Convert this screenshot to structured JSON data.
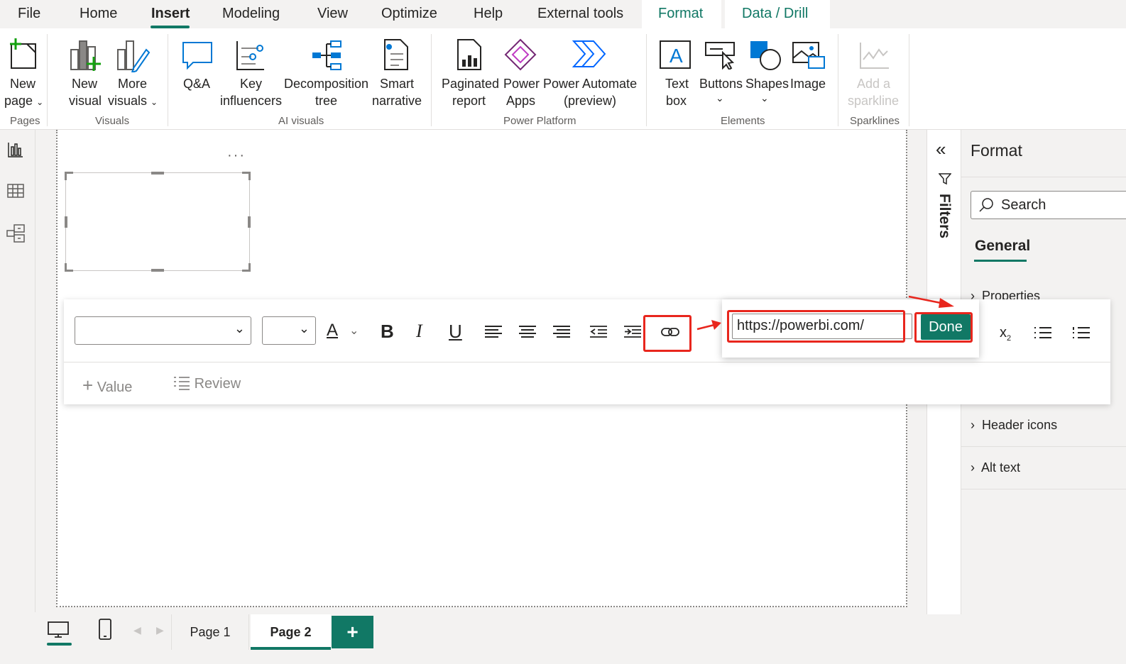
{
  "menubar": {
    "items": [
      "File",
      "Home",
      "Insert",
      "Modeling",
      "View",
      "Optimize",
      "Help",
      "External tools",
      "Format",
      "Data / Drill"
    ],
    "active": "Insert"
  },
  "ribbon": {
    "pages": {
      "new_page_1": "New",
      "new_page_2": "page",
      "group": "Pages"
    },
    "visuals": {
      "new_visual_1": "New",
      "new_visual_2": "visual",
      "more_visuals_1": "More",
      "more_visuals_2": "visuals",
      "group": "Visuals"
    },
    "ai": {
      "qa": "Q&A",
      "key_1": "Key",
      "key_2": "influencers",
      "decomp_1": "Decomposition",
      "decomp_2": "tree",
      "smart_1": "Smart",
      "smart_2": "narrative",
      "group": "AI visuals"
    },
    "platform": {
      "paginated_1": "Paginated",
      "paginated_2": "report",
      "apps_1": "Power",
      "apps_2": "Apps",
      "automate_1": "Power Automate",
      "automate_2": "(preview)",
      "group": "Power Platform"
    },
    "elements": {
      "text_1": "Text",
      "text_2": "box",
      "buttons": "Buttons",
      "shapes": "Shapes",
      "image": "Image",
      "group": "Elements"
    },
    "sparklines": {
      "add_1": "Add a",
      "add_2": "sparkline",
      "group": "Sparklines"
    }
  },
  "filters": {
    "label": "Filters"
  },
  "format_pane": {
    "title": "Format",
    "search_placeholder": "Search",
    "tab": "General",
    "sections": [
      "Properties",
      "Header icons",
      "Alt text"
    ]
  },
  "text_toolbar": {
    "font_value": "",
    "size_value": "",
    "value_label": "Value",
    "review_label": "Review"
  },
  "link_popup": {
    "url": "https://powerbi.com/",
    "done_label": "Done"
  },
  "pages": {
    "tabs": [
      "Page 1",
      "Page 2"
    ],
    "active": "Page 2",
    "add_label": "+"
  },
  "colors": {
    "accent": "#117865",
    "annotation": "#e8261d"
  }
}
